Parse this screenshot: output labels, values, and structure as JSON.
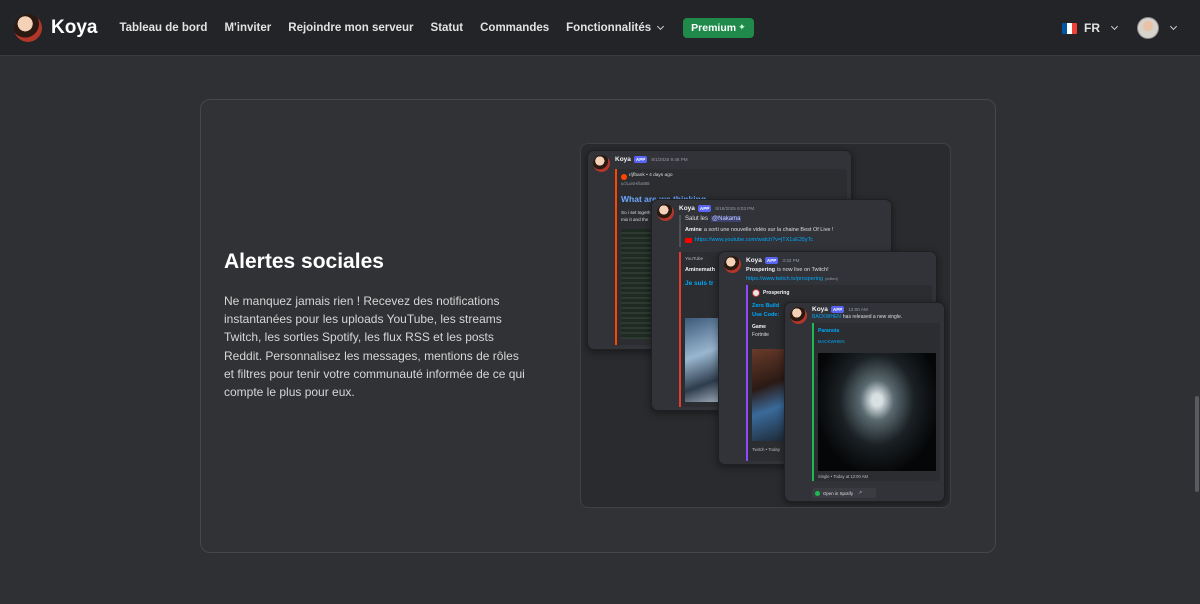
{
  "brand": {
    "name": "Koya",
    "logo_icon": "koya-logo-icon"
  },
  "nav": {
    "links": [
      {
        "label": "Tableau de bord"
      },
      {
        "label": "M'inviter"
      },
      {
        "label": "Rejoindre mon serveur"
      },
      {
        "label": "Statut"
      },
      {
        "label": "Commandes"
      },
      {
        "label": "Fonctionnalités"
      }
    ],
    "premium_label": "Premium",
    "language": "FR",
    "flag_colors": [
      "#0055a4",
      "#ffffff",
      "#ef4135"
    ]
  },
  "feature": {
    "title": "Alertes sociales",
    "description": "Ne manquez jamais rien ! Recevez des notifications instantanées pour les uploads YouTube, les streams Twitch, les sorties Spotify, les flux RSS et les posts Reddit. Personnalisez les messages, mentions de rôles et filtres pour tenir votre communauté informée de ce qui compte le plus pour eux."
  },
  "preview": {
    "reddit": {
      "bot": "Koya",
      "badge": "APP",
      "time": "8/1/2025 9:46 PM",
      "author": "r/jfbank • 4 days ago",
      "sub": "u/JLuisHilla888",
      "title": "What are we thinking",
      "snippet1": "So i set togeth",
      "snippet2": "mix it and the"
    },
    "youtube": {
      "bot": "Koya",
      "badge": "APP",
      "time": "5/18/2025 6:03 PM",
      "greeting": "Salut les",
      "mention": "@Nakama",
      "announce_name": "Amine",
      "announce": "a sorti une nouvelle vidéo sur la chaine Best Of Live !",
      "link": "https://www.youtube.com/watch?v=jTX1sE35yTc",
      "site": "YouTube",
      "channel": "Aminemath",
      "video_title": "Je suis tr"
    },
    "twitch": {
      "bot": "Koya",
      "badge": "APP",
      "time": "3:33 PM",
      "streamer": "Prospering",
      "live_text": "is now live on Twitch!",
      "link": "https://www.twitch.tv/prospering",
      "link_note": "(edited)",
      "embed_author": "Prospering",
      "stream_title": "Zero Build",
      "use_code": "Use Code:",
      "game_label": "Game",
      "game": "Fortnite",
      "footer": "Twitch • Today"
    },
    "spotify": {
      "bot": "Koya",
      "badge": "APP",
      "time": "12:00 AM",
      "artist": "BACKWHEN",
      "release_text": "has released a new single.",
      "track": "Paranoia",
      "embed_artist": "BACKWHEN",
      "footer": "Single • Today at 12:00 AM",
      "button": "Open in Spotify"
    }
  }
}
